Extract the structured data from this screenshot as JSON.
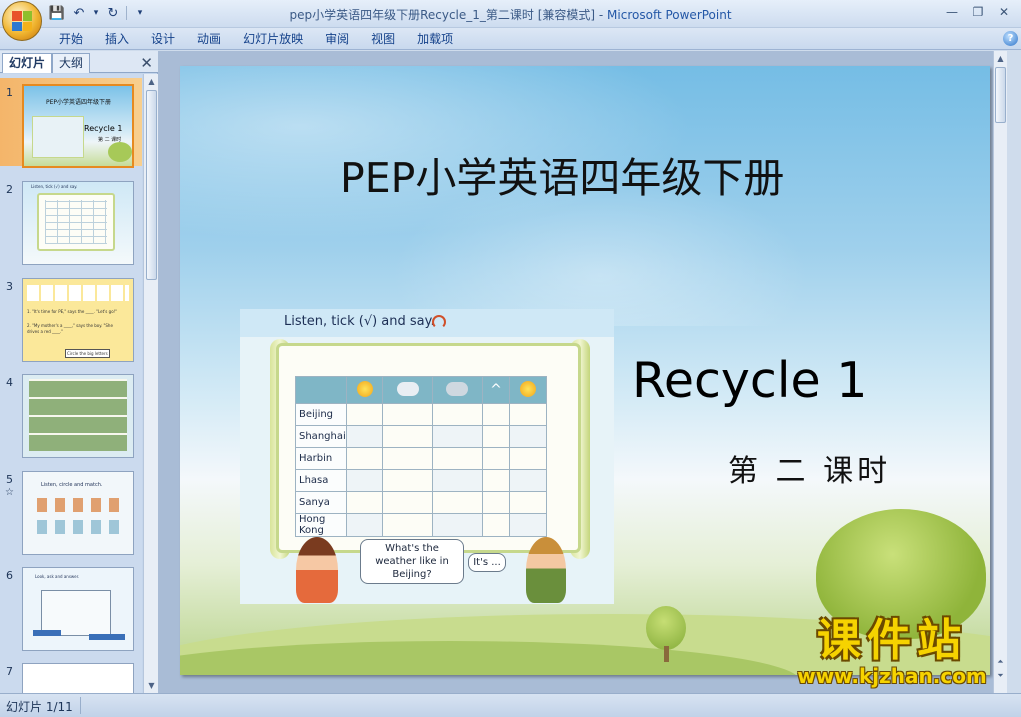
{
  "window": {
    "title": "pep小学英语四年级下册Recycle_1_第二课时 [兼容模式] - ",
    "app_name": "Microsoft PowerPoint"
  },
  "qat": {
    "save": "💾",
    "undo": "↶",
    "undo_dropdown": "▾",
    "redo": "↻",
    "customize": "▾"
  },
  "window_controls": {
    "minimize": "—",
    "restore": "❐",
    "close": "✕"
  },
  "ribbon": {
    "tabs": [
      "开始",
      "插入",
      "设计",
      "动画",
      "幻灯片放映",
      "审阅",
      "视图",
      "加载项"
    ],
    "help": "?"
  },
  "panel": {
    "tab_slides": "幻灯片",
    "tab_outline": "大纲",
    "close": "✕",
    "slide_numbers": [
      "1",
      "2",
      "3",
      "4",
      "5",
      "6",
      "7"
    ],
    "slide5_marker": "☆",
    "thumb1_title": "PEP小学英语四年级下册",
    "thumb1_recycle": "Recycle 1",
    "thumb1_lesson": "第 二 课时",
    "thumb2_instruction": "Listen, tick (√) and say.",
    "thumb3_line1": "1. \"It's time for PE,\" says the ____. \"Let's go!\"",
    "thumb3_line2": "2. \"My mother's a ____,\" says the boy. \"She drives a red ____.\"",
    "thumb3_circle": "Circle the big letters",
    "thumb5_instruction": "Listen, circle and match.",
    "thumb6_instruction": "Look, ask and answer."
  },
  "slide": {
    "title": "PEP小学英语四年级下册",
    "subtitle": "Recycle 1",
    "lesson": "第 二 课时",
    "instruction": "Listen, tick (√) and say.",
    "cities": [
      "Beijing",
      "Shanghai",
      "Harbin",
      "Lhasa",
      "Sanya",
      "Hong Kong"
    ],
    "bubble_girl": "What's the weather like in Beijing?",
    "bubble_boy": "It's ..."
  },
  "watermark": {
    "chinese": "课件站",
    "url": "www.kjzhan.com"
  },
  "status": {
    "slide_counter": "幻灯片 1/11"
  },
  "colors": {
    "selection": "#f4b56a",
    "ribbon_text": "#15428b"
  }
}
